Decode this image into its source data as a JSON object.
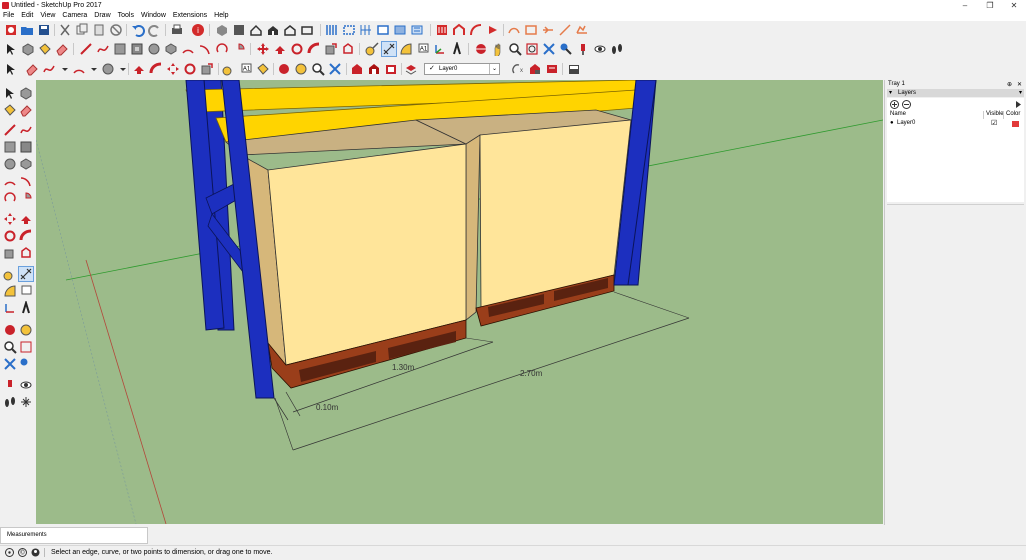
{
  "window": {
    "title": "Untitled - SketchUp Pro 2017",
    "controls": [
      "–",
      "❐",
      "✕"
    ]
  },
  "menu": [
    "File",
    "Edit",
    "View",
    "Camera",
    "Draw",
    "Tools",
    "Window",
    "Extensions",
    "Help"
  ],
  "toolbar": {
    "layer_checkmark": "✓",
    "layer_value": "Layer0",
    "dropdown_arrow": "⌄"
  },
  "viewport": {
    "dim_labels": [
      "1.30m",
      "2.70m",
      "0.10m"
    ],
    "colors": {
      "ground": "#9cbb8a",
      "rack_upright": "#1c2fbf",
      "beam": "#ffd400",
      "box_front": "#ffe59a",
      "box_side": "#d6b77a",
      "box_top": "#c9b182",
      "pallet": "#9a3e1a"
    }
  },
  "tray": {
    "title": "Tray 1",
    "pin": "⊕",
    "close": "✕",
    "panel_title": "Layers",
    "panel_arrow": "▾",
    "columns": [
      "Name",
      "Visible",
      "Color"
    ],
    "layers": [
      {
        "bullet": "●",
        "name": "Layer0",
        "visible": "☑",
        "color": "#e23a3a"
      }
    ]
  },
  "measurements": {
    "label": "Measurements"
  },
  "status": {
    "text": "Select an edge, curve, or two points to dimension, or drag one to move."
  }
}
